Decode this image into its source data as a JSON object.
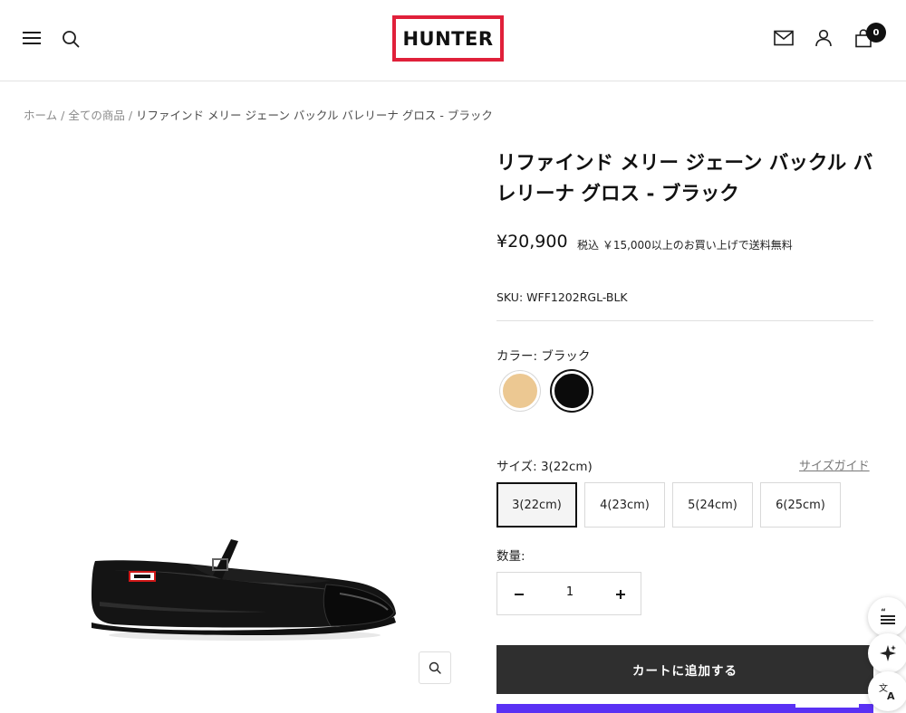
{
  "header": {
    "logo_text": "HUNTER",
    "cart_count": "0",
    "accent_color": "#e0203a"
  },
  "breadcrumb": {
    "items": [
      "ホーム",
      "全ての商品"
    ],
    "separator": "/",
    "current": "リファインド メリー ジェーン バックル バレリーナ グロス - ブラック"
  },
  "product": {
    "title": "リファインド メリー ジェーン バックル バレリーナ グロス - ブラック",
    "price": "¥20,900",
    "tax_note": "税込 ￥15,000以上のお買い上げで送料無料",
    "sku_label": "SKU:",
    "sku": "WFF1202RGL-BLK",
    "color_label": "カラー:",
    "color_value": "ブラック",
    "swatches": [
      {
        "name": "beige",
        "color": "#ecc892"
      },
      {
        "name": "black",
        "color": "#0b0b0b",
        "selected": true
      }
    ],
    "size_label": "サイズ:",
    "size_value": "3(22cm)",
    "size_guide": "サイズガイド",
    "sizes": [
      "3(22cm)",
      "4(23cm)",
      "5(24cm)",
      "6(25cm)"
    ],
    "selected_size": "3(22cm)",
    "quantity_label": "数量:",
    "quantity": "1",
    "add_to_cart": "カートに追加する",
    "buy_button_color": "#5a31f4"
  },
  "icons": {
    "menu": "hamburger-icon",
    "search": "search-icon",
    "mail": "mail-icon",
    "account": "user-icon",
    "cart": "cart-icon",
    "zoom": "zoom-icon",
    "reviews": "quote-icon",
    "ai": "sparkle-icon",
    "translate": "translate-icon"
  }
}
